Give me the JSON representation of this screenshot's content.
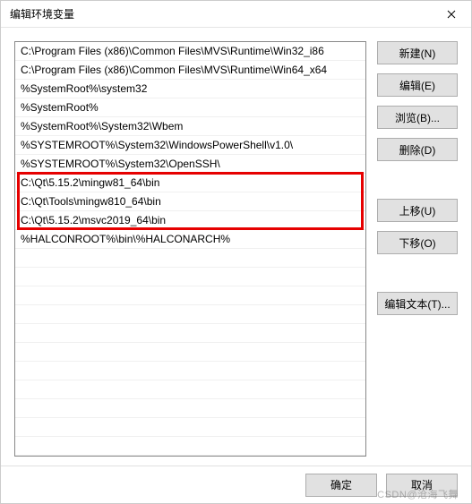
{
  "title": "编辑环境变量",
  "list": {
    "items": [
      "C:\\Program Files (x86)\\Common Files\\MVS\\Runtime\\Win32_i86",
      "C:\\Program Files (x86)\\Common Files\\MVS\\Runtime\\Win64_x64",
      "%SystemRoot%\\system32",
      "%SystemRoot%",
      "%SystemRoot%\\System32\\Wbem",
      "%SYSTEMROOT%\\System32\\WindowsPowerShell\\v1.0\\",
      "%SYSTEMROOT%\\System32\\OpenSSH\\",
      "C:\\Qt\\5.15.2\\mingw81_64\\bin",
      "C:\\Qt\\Tools\\mingw810_64\\bin",
      "C:\\Qt\\5.15.2\\msvc2019_64\\bin",
      "%HALCONROOT%\\bin\\%HALCONARCH%"
    ],
    "highlight_start": 7,
    "highlight_end": 9,
    "total_rows": 22
  },
  "buttons": {
    "new": "新建(N)",
    "edit": "编辑(E)",
    "browse": "浏览(B)...",
    "delete": "删除(D)",
    "moveup": "上移(U)",
    "movedown": "下移(O)",
    "edittext": "编辑文本(T)..."
  },
  "footer": {
    "ok": "确定",
    "cancel": "取消"
  },
  "watermark": "CSDN@沧海飞舞"
}
